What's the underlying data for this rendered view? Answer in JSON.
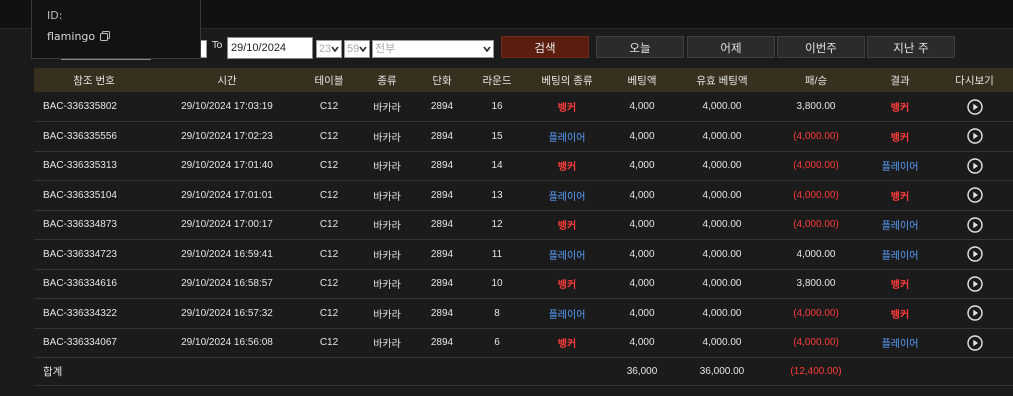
{
  "popup": {
    "id_label": "ID:",
    "username": "flamingo",
    "copy_icon": "copy-icon"
  },
  "filters": {
    "to_label": "To",
    "to_date": "29/10/2024",
    "hour": "23",
    "minute": "59",
    "type_select": "전부"
  },
  "buttons": {
    "search": "검색",
    "today": "오늘",
    "yesterday": "어제",
    "this_week": "이번주",
    "last_week": "지난 주"
  },
  "columns": [
    "참조 번호",
    "시간",
    "테이블",
    "종류",
    "단화",
    "라운드",
    "베팅의 종류",
    "베팅액",
    "유효 베팅액",
    "패/승",
    "결과",
    "다시보기"
  ],
  "rows": [
    {
      "ref": "BAC-336335802",
      "time": "29/10/2024 17:03:19",
      "table": "C12",
      "kind": "바카라",
      "shoe": "2894",
      "round": "16",
      "bet_type": "뱅커",
      "bet_type_class": "banker",
      "bet": "4,000",
      "valid_bet": "4,000.00",
      "win_loss": "3,800.00",
      "win_loss_class": "",
      "result": "뱅커",
      "result_class": "banker"
    },
    {
      "ref": "BAC-336335556",
      "time": "29/10/2024 17:02:23",
      "table": "C12",
      "kind": "바카라",
      "shoe": "2894",
      "round": "15",
      "bet_type": "플레이어",
      "bet_type_class": "player",
      "bet": "4,000",
      "valid_bet": "4,000.00",
      "win_loss": "(4,000.00)",
      "win_loss_class": "neg",
      "result": "뱅커",
      "result_class": "banker"
    },
    {
      "ref": "BAC-336335313",
      "time": "29/10/2024 17:01:40",
      "table": "C12",
      "kind": "바카라",
      "shoe": "2894",
      "round": "14",
      "bet_type": "뱅커",
      "bet_type_class": "banker",
      "bet": "4,000",
      "valid_bet": "4,000.00",
      "win_loss": "(4,000.00)",
      "win_loss_class": "neg",
      "result": "플레이어",
      "result_class": "player"
    },
    {
      "ref": "BAC-336335104",
      "time": "29/10/2024 17:01:01",
      "table": "C12",
      "kind": "바카라",
      "shoe": "2894",
      "round": "13",
      "bet_type": "플레이어",
      "bet_type_class": "player",
      "bet": "4,000",
      "valid_bet": "4,000.00",
      "win_loss": "(4,000.00)",
      "win_loss_class": "neg",
      "result": "뱅커",
      "result_class": "banker"
    },
    {
      "ref": "BAC-336334873",
      "time": "29/10/2024 17:00:17",
      "table": "C12",
      "kind": "바카라",
      "shoe": "2894",
      "round": "12",
      "bet_type": "뱅커",
      "bet_type_class": "banker",
      "bet": "4,000",
      "valid_bet": "4,000.00",
      "win_loss": "(4,000.00)",
      "win_loss_class": "neg",
      "result": "플레이어",
      "result_class": "player"
    },
    {
      "ref": "BAC-336334723",
      "time": "29/10/2024 16:59:41",
      "table": "C12",
      "kind": "바카라",
      "shoe": "2894",
      "round": "11",
      "bet_type": "플레이어",
      "bet_type_class": "player",
      "bet": "4,000",
      "valid_bet": "4,000.00",
      "win_loss": "4,000.00",
      "win_loss_class": "",
      "result": "플레이어",
      "result_class": "player"
    },
    {
      "ref": "BAC-336334616",
      "time": "29/10/2024 16:58:57",
      "table": "C12",
      "kind": "바카라",
      "shoe": "2894",
      "round": "10",
      "bet_type": "뱅커",
      "bet_type_class": "banker",
      "bet": "4,000",
      "valid_bet": "4,000.00",
      "win_loss": "3,800.00",
      "win_loss_class": "",
      "result": "뱅커",
      "result_class": "banker"
    },
    {
      "ref": "BAC-336334322",
      "time": "29/10/2024 16:57:32",
      "table": "C12",
      "kind": "바카라",
      "shoe": "2894",
      "round": "8",
      "bet_type": "플레이어",
      "bet_type_class": "player",
      "bet": "4,000",
      "valid_bet": "4,000.00",
      "win_loss": "(4,000.00)",
      "win_loss_class": "neg",
      "result": "뱅커",
      "result_class": "banker"
    },
    {
      "ref": "BAC-336334067",
      "time": "29/10/2024 16:56:08",
      "table": "C12",
      "kind": "바카라",
      "shoe": "2894",
      "round": "6",
      "bet_type": "뱅커",
      "bet_type_class": "banker",
      "bet": "4,000",
      "valid_bet": "4,000.00",
      "win_loss": "(4,000.00)",
      "win_loss_class": "neg",
      "result": "플레이어",
      "result_class": "player"
    }
  ],
  "total": {
    "label": "합계",
    "bet": "36,000",
    "valid_bet": "36,000.00",
    "win_loss": "(12,400.00)"
  },
  "colors": {
    "banker": "#ff3b3b",
    "player": "#5aa0ff",
    "header_bg": "#37301f",
    "search_bg": "#5a1d0e"
  },
  "icons": {
    "replay": "play-circle-icon"
  }
}
